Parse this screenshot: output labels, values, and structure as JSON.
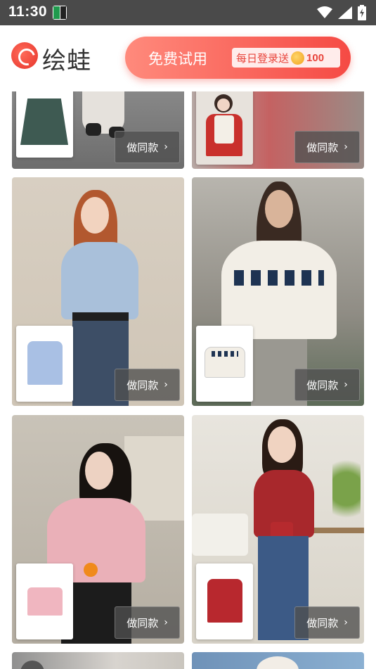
{
  "status_bar": {
    "time": "11:30"
  },
  "header": {
    "brand": "绘蛙",
    "free_trial_label": "免费试用",
    "daily_login_label": "每日登录送",
    "daily_login_coins": "100"
  },
  "feed": {
    "make_same_label": "做同款",
    "cards": [
      {
        "description": "top-left partial card"
      },
      {
        "description": "top-right partial card"
      },
      {
        "description": "blue striped shirt with denim skirt"
      },
      {
        "description": "fair isle knit sweater"
      },
      {
        "description": "pink t-shirt"
      },
      {
        "description": "red cardigan with jeans"
      }
    ]
  },
  "colors": {
    "accent": "#f54a44",
    "status_bar": "#4a4a4a"
  }
}
